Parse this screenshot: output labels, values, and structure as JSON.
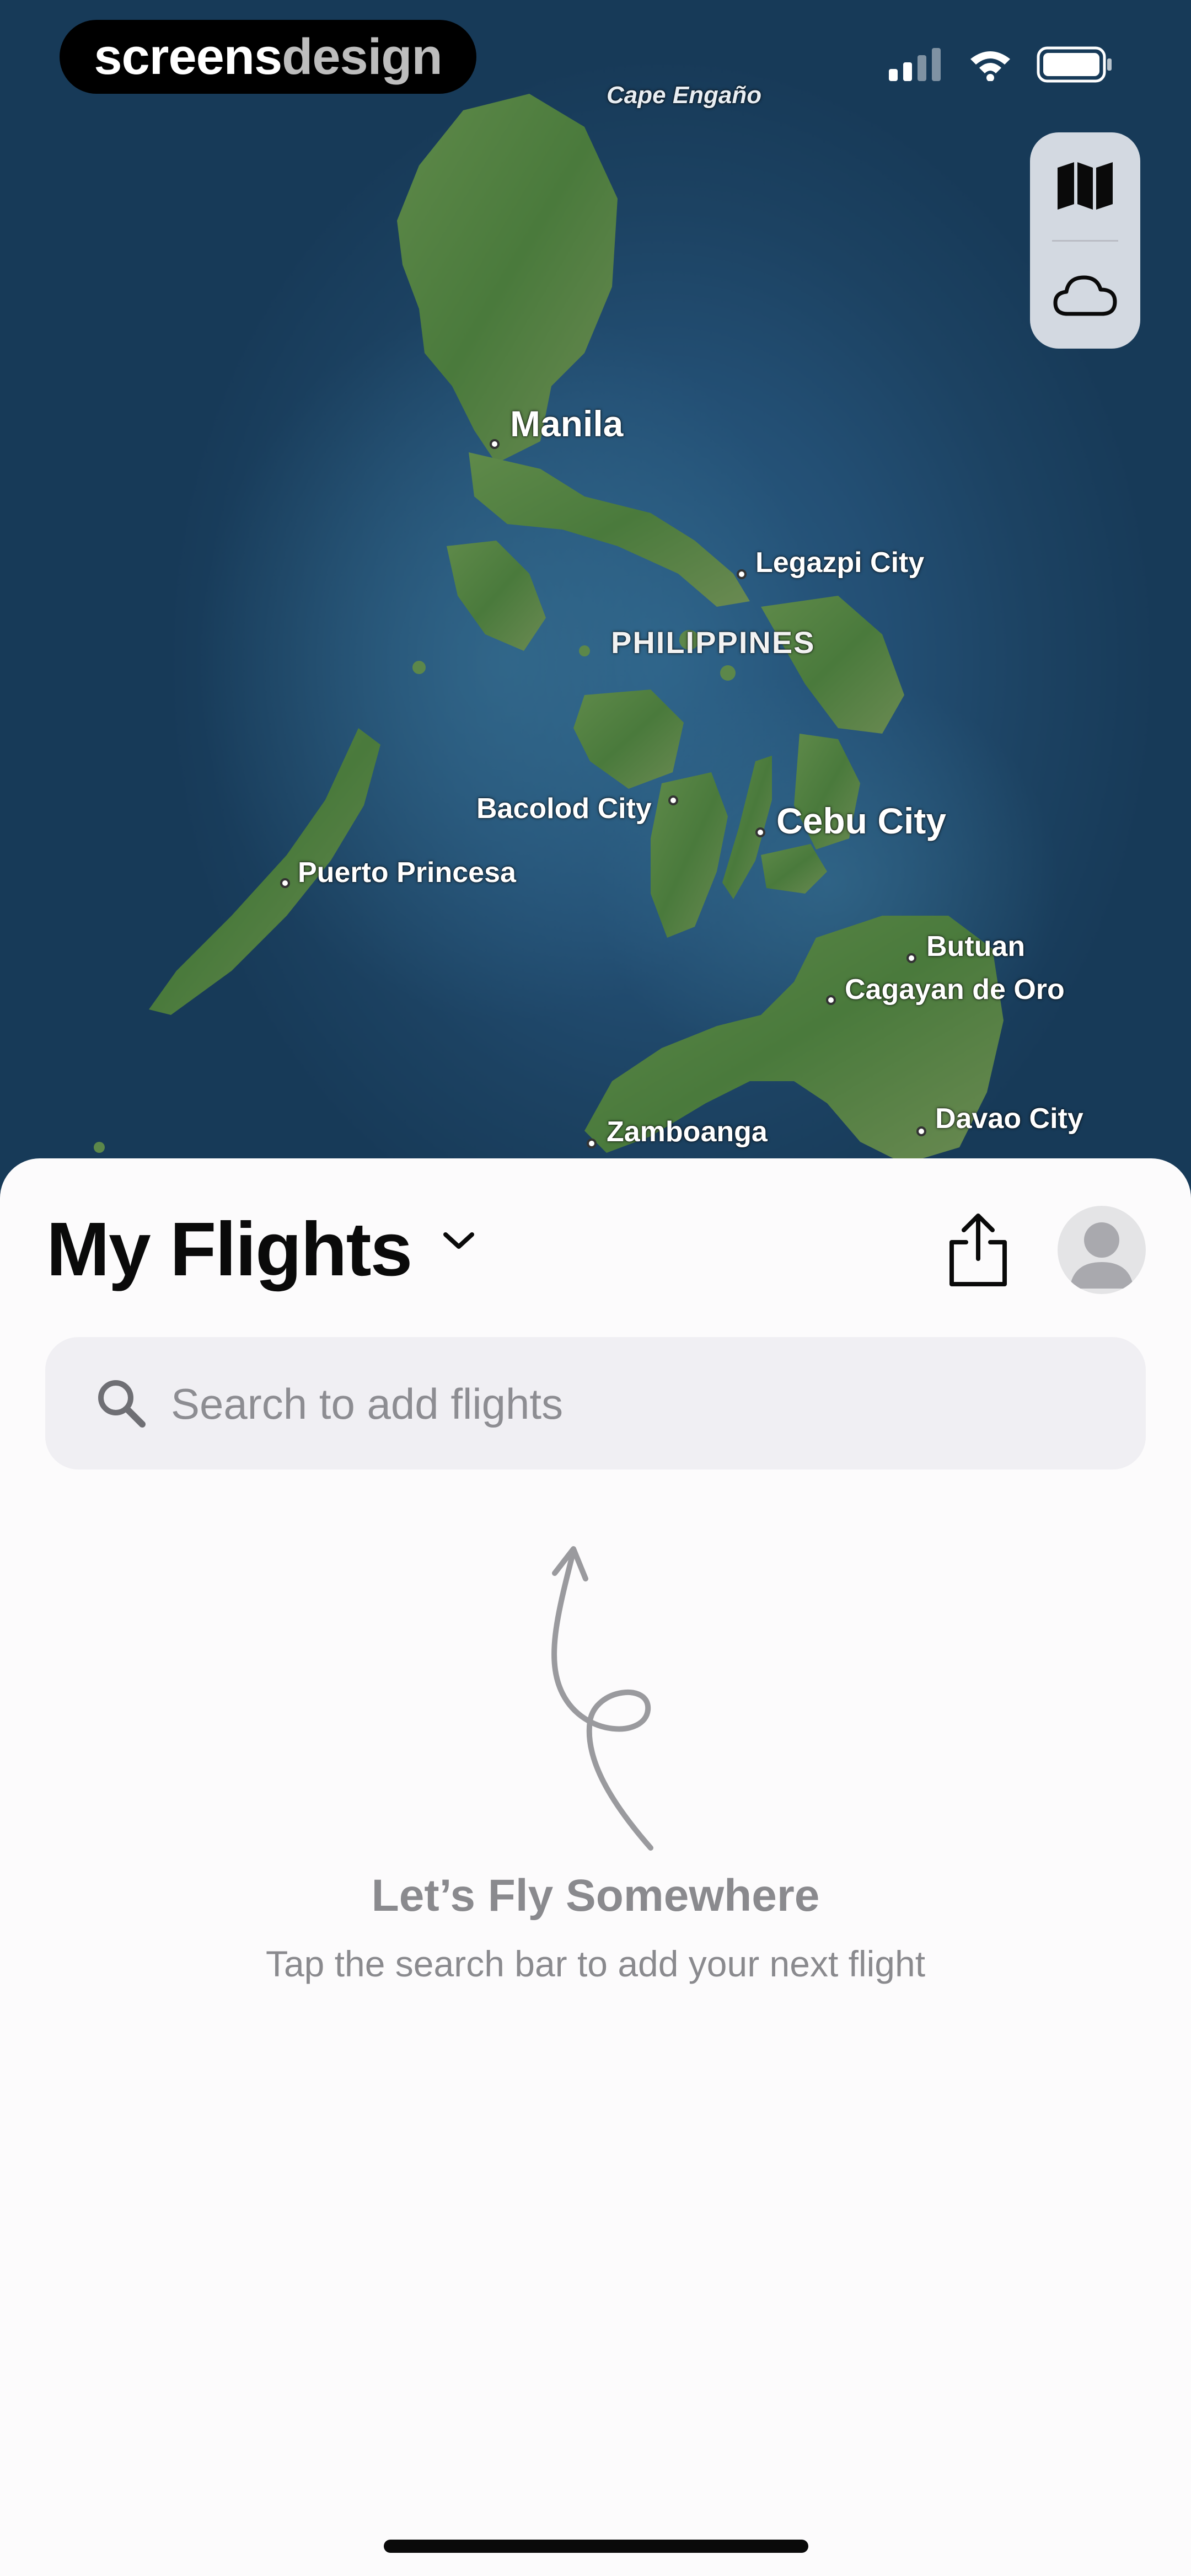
{
  "status_bar": {
    "brand_part1": "screens",
    "brand_part2": "design"
  },
  "map": {
    "places": {
      "cape_engano": "Cape Engaño",
      "manila": "Manila",
      "legazpi": "Legazpi City",
      "philippines": "PHILIPPINES",
      "bacolod": "Bacolod City",
      "cebu": "Cebu City",
      "puerto_princesa": "Puerto Princesa",
      "butuan": "Butuan",
      "cagayan": "Cagayan de Oro",
      "zamboanga": "Zamboanga",
      "davao": "Davao City"
    },
    "controls": {
      "map_style_icon": "map-icon",
      "weather_icon": "cloud-icon"
    }
  },
  "sheet": {
    "title": "My Flights",
    "search": {
      "placeholder": "Search to add flights"
    },
    "empty_state": {
      "title": "Let’s Fly Somewhere",
      "subtitle": "Tap the search bar to add your next flight"
    }
  }
}
